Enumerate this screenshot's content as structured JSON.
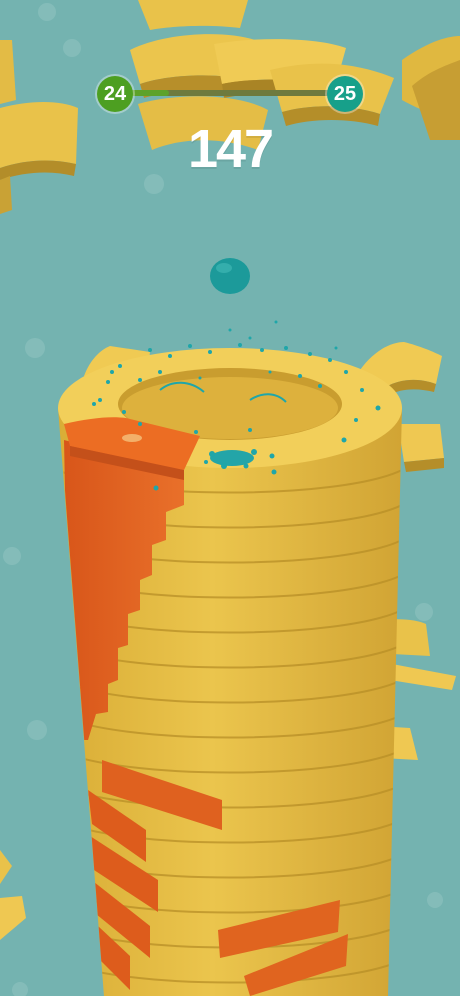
{
  "game": {
    "level_current": "24",
    "level_next": "25",
    "level_progress": 0.2,
    "score": "147"
  },
  "colors": {
    "background": "#74b3b0",
    "tower_yellow": "#e9c24a",
    "tower_shade": "#c9a235",
    "danger_orange": "#e0641f",
    "ball_teal": "#1c9a9a",
    "level_current_green": "#4d9f21",
    "level_next_teal": "#17a08a"
  },
  "icons": {
    "ball": "ball-icon",
    "splash": "splash-particles-icon"
  }
}
